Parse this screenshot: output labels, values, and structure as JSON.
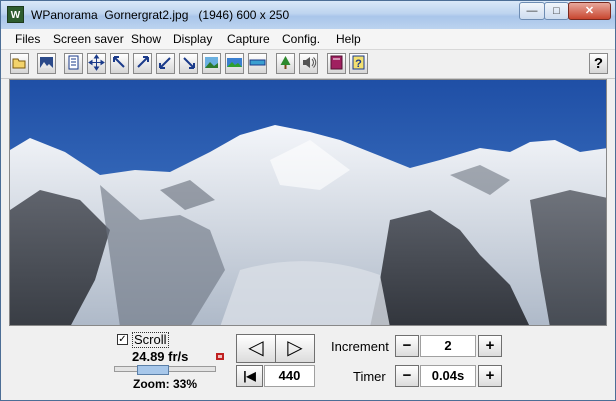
{
  "window": {
    "title": "WPanorama  Gornergrat2.jpg   (1946) 600 x 250",
    "app_icon": "W",
    "minimize_glyph": "—",
    "maximize_glyph": "□",
    "close_glyph": "✕"
  },
  "menu": [
    "Files",
    "Screen saver",
    "Show",
    "Display",
    "Capture",
    "Config.",
    "Help"
  ],
  "toolbar": {
    "icons": [
      "open-file-icon",
      "picture-icon",
      "page-icon",
      "move-icon",
      "arrow-nw-icon",
      "arrow-ne-icon",
      "arrow-sw-icon",
      "arrow-se-icon",
      "landscape-icon",
      "panorama-icon",
      "strip-icon",
      "tree-icon",
      "sound-icon",
      "book-icon",
      "help-doc-icon"
    ],
    "help_label": "?"
  },
  "controls": {
    "scroll_label": "Scroll",
    "scroll_checked": "✓",
    "speed": "24.89 fr/s",
    "zoom": "Zoom: 33%",
    "zoom_fraction": 0.33,
    "left_glyph": "◁",
    "right_glyph": "▷",
    "first_glyph": "|◀",
    "position": "440",
    "increment_label": "Increment",
    "increment_value": "2",
    "timer_label": "Timer",
    "timer_value": "0.04s",
    "minus": "−",
    "plus": "+"
  }
}
